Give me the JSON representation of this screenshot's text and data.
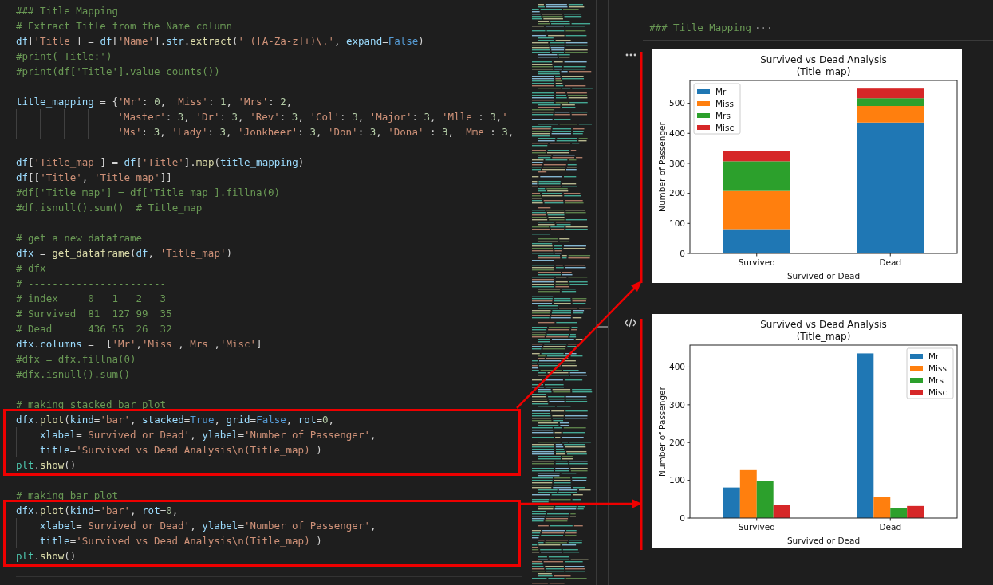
{
  "editor": {
    "sections": [
      {
        "highlighted": false,
        "lines": [
          {
            "tokens": [
              {
                "kind": "comment",
                "text": "### Title Mapping"
              }
            ]
          },
          {
            "tokens": [
              {
                "kind": "comment",
                "text": "# Extract Title from the Name column"
              }
            ]
          },
          {
            "tokens": [
              {
                "kind": "name",
                "text": "df"
              },
              {
                "kind": "plain",
                "text": "["
              },
              {
                "kind": "string",
                "text": "'Title'"
              },
              {
                "kind": "plain",
                "text": "] = "
              },
              {
                "kind": "name",
                "text": "df"
              },
              {
                "kind": "plain",
                "text": "["
              },
              {
                "kind": "string",
                "text": "'Name'"
              },
              {
                "kind": "plain",
                "text": "]."
              },
              {
                "kind": "name",
                "text": "str"
              },
              {
                "kind": "plain",
                "text": "."
              },
              {
                "kind": "func",
                "text": "extract"
              },
              {
                "kind": "plain",
                "text": "("
              },
              {
                "kind": "string",
                "text": "' ([A-Za-z]+)\\.'"
              },
              {
                "kind": "plain",
                "text": ", "
              },
              {
                "kind": "name",
                "text": "expand"
              },
              {
                "kind": "plain",
                "text": "="
              },
              {
                "kind": "const",
                "text": "False"
              },
              {
                "kind": "plain",
                "text": ")"
              }
            ]
          },
          {
            "tokens": [
              {
                "kind": "comment",
                "text": "#print('Title:')"
              }
            ]
          },
          {
            "tokens": [
              {
                "kind": "comment",
                "text": "#print(df['Title'].value_counts())"
              }
            ]
          },
          {
            "kind": "blank"
          },
          {
            "tokens": [
              {
                "kind": "name",
                "text": "title_mapping"
              },
              {
                "kind": "plain",
                "text": " = {"
              },
              {
                "kind": "string",
                "text": "'Mr'"
              },
              {
                "kind": "plain",
                "text": ": "
              },
              {
                "kind": "number",
                "text": "0"
              },
              {
                "kind": "plain",
                "text": ", "
              },
              {
                "kind": "string",
                "text": "'Miss'"
              },
              {
                "kind": "plain",
                "text": ": "
              },
              {
                "kind": "number",
                "text": "1"
              },
              {
                "kind": "plain",
                "text": ", "
              },
              {
                "kind": "string",
                "text": "'Mrs'"
              },
              {
                "kind": "plain",
                "text": ": "
              },
              {
                "kind": "number",
                "text": "2"
              },
              {
                "kind": "plain",
                "text": ","
              }
            ]
          },
          {
            "kind": "dict-continuation",
            "tokens": [
              {
                "kind": "string",
                "text": "'Master'"
              },
              {
                "kind": "plain",
                "text": ": "
              },
              {
                "kind": "number",
                "text": "3"
              },
              {
                "kind": "plain",
                "text": ", "
              },
              {
                "kind": "string",
                "text": "'Dr'"
              },
              {
                "kind": "plain",
                "text": ": "
              },
              {
                "kind": "number",
                "text": "3"
              },
              {
                "kind": "plain",
                "text": ", "
              },
              {
                "kind": "string",
                "text": "'Rev'"
              },
              {
                "kind": "plain",
                "text": ": "
              },
              {
                "kind": "number",
                "text": "3"
              },
              {
                "kind": "plain",
                "text": ", "
              },
              {
                "kind": "string",
                "text": "'Col'"
              },
              {
                "kind": "plain",
                "text": ": "
              },
              {
                "kind": "number",
                "text": "3"
              },
              {
                "kind": "plain",
                "text": ", "
              },
              {
                "kind": "string",
                "text": "'Major'"
              },
              {
                "kind": "plain",
                "text": ": "
              },
              {
                "kind": "number",
                "text": "3"
              },
              {
                "kind": "plain",
                "text": ", "
              },
              {
                "kind": "string",
                "text": "'Mlle'"
              },
              {
                "kind": "plain",
                "text": ": "
              },
              {
                "kind": "number",
                "text": "3"
              },
              {
                "kind": "plain",
                "text": ","
              },
              {
                "kind": "string",
                "text": "'"
              }
            ]
          },
          {
            "kind": "dict-continuation",
            "tokens": [
              {
                "kind": "string",
                "text": "'Ms'"
              },
              {
                "kind": "plain",
                "text": ": "
              },
              {
                "kind": "number",
                "text": "3"
              },
              {
                "kind": "plain",
                "text": ", "
              },
              {
                "kind": "string",
                "text": "'Lady'"
              },
              {
                "kind": "plain",
                "text": ": "
              },
              {
                "kind": "number",
                "text": "3"
              },
              {
                "kind": "plain",
                "text": ", "
              },
              {
                "kind": "string",
                "text": "'Jonkheer'"
              },
              {
                "kind": "plain",
                "text": ": "
              },
              {
                "kind": "number",
                "text": "3"
              },
              {
                "kind": "plain",
                "text": ", "
              },
              {
                "kind": "string",
                "text": "'Don'"
              },
              {
                "kind": "plain",
                "text": ": "
              },
              {
                "kind": "number",
                "text": "3"
              },
              {
                "kind": "plain",
                "text": ", "
              },
              {
                "kind": "string",
                "text": "'Dona'"
              },
              {
                "kind": "plain",
                "text": " : "
              },
              {
                "kind": "number",
                "text": "3"
              },
              {
                "kind": "plain",
                "text": ", "
              },
              {
                "kind": "string",
                "text": "'Mme'"
              },
              {
                "kind": "plain",
                "text": ": "
              },
              {
                "kind": "number",
                "text": "3"
              },
              {
                "kind": "plain",
                "text": ","
              }
            ]
          },
          {
            "kind": "blank"
          },
          {
            "tokens": [
              {
                "kind": "name",
                "text": "df"
              },
              {
                "kind": "plain",
                "text": "["
              },
              {
                "kind": "string",
                "text": "'Title_map'"
              },
              {
                "kind": "plain",
                "text": "] = "
              },
              {
                "kind": "name",
                "text": "df"
              },
              {
                "kind": "plain",
                "text": "["
              },
              {
                "kind": "string",
                "text": "'Title'"
              },
              {
                "kind": "plain",
                "text": "]."
              },
              {
                "kind": "func",
                "text": "map"
              },
              {
                "kind": "plain",
                "text": "("
              },
              {
                "kind": "name",
                "text": "title_mapping"
              },
              {
                "kind": "plain",
                "text": ")"
              }
            ]
          },
          {
            "tokens": [
              {
                "kind": "name",
                "text": "df"
              },
              {
                "kind": "plain",
                "text": "[["
              },
              {
                "kind": "string",
                "text": "'Title'"
              },
              {
                "kind": "plain",
                "text": ", "
              },
              {
                "kind": "string",
                "text": "'Title_map'"
              },
              {
                "kind": "plain",
                "text": "]]"
              }
            ]
          },
          {
            "tokens": [
              {
                "kind": "comment",
                "text": "#df['Title_map'] = df['Title_map'].fillna(0)"
              }
            ]
          },
          {
            "tokens": [
              {
                "kind": "comment",
                "text": "#df.isnull().sum()  # Title_map"
              }
            ]
          },
          {
            "kind": "blank"
          },
          {
            "tokens": [
              {
                "kind": "comment",
                "text": "# get a new dataframe"
              }
            ]
          },
          {
            "tokens": [
              {
                "kind": "name",
                "text": "dfx"
              },
              {
                "kind": "plain",
                "text": " = "
              },
              {
                "kind": "func",
                "text": "get_dataframe"
              },
              {
                "kind": "plain",
                "text": "("
              },
              {
                "kind": "name",
                "text": "df"
              },
              {
                "kind": "plain",
                "text": ", "
              },
              {
                "kind": "string",
                "text": "'Title_map'"
              },
              {
                "kind": "plain",
                "text": ")"
              }
            ]
          },
          {
            "tokens": [
              {
                "kind": "comment",
                "text": "# dfx"
              }
            ]
          },
          {
            "tokens": [
              {
                "kind": "comment",
                "text": "# -----------------------"
              }
            ]
          },
          {
            "tokens": [
              {
                "kind": "comment",
                "text": "# index     0   1   2   3"
              }
            ]
          },
          {
            "tokens": [
              {
                "kind": "comment",
                "text": "# Survived  81  127 99  35"
              }
            ]
          },
          {
            "tokens": [
              {
                "kind": "comment",
                "text": "# Dead      436 55  26  32"
              }
            ]
          },
          {
            "tokens": [
              {
                "kind": "name",
                "text": "dfx"
              },
              {
                "kind": "plain",
                "text": "."
              },
              {
                "kind": "name",
                "text": "columns"
              },
              {
                "kind": "plain",
                "text": " =  ["
              },
              {
                "kind": "string",
                "text": "'Mr'"
              },
              {
                "kind": "plain",
                "text": ","
              },
              {
                "kind": "string",
                "text": "'Miss'"
              },
              {
                "kind": "plain",
                "text": ","
              },
              {
                "kind": "string",
                "text": "'Mrs'"
              },
              {
                "kind": "plain",
                "text": ","
              },
              {
                "kind": "string",
                "text": "'Misc'"
              },
              {
                "kind": "plain",
                "text": "]"
              }
            ]
          },
          {
            "tokens": [
              {
                "kind": "comment",
                "text": "#dfx = dfx.fillna(0)"
              }
            ]
          },
          {
            "tokens": [
              {
                "kind": "comment",
                "text": "#dfx.isnull().sum()"
              }
            ]
          },
          {
            "kind": "blank"
          },
          {
            "tokens": [
              {
                "kind": "comment",
                "text": "# making stacked bar plot"
              }
            ]
          }
        ]
      },
      {
        "highlighted": true,
        "lines": [
          {
            "tokens": [
              {
                "kind": "name",
                "text": "dfx"
              },
              {
                "kind": "plain",
                "text": "."
              },
              {
                "kind": "func",
                "text": "plot"
              },
              {
                "kind": "plain",
                "text": "("
              },
              {
                "kind": "name",
                "text": "kind"
              },
              {
                "kind": "plain",
                "text": "="
              },
              {
                "kind": "string",
                "text": "'bar'"
              },
              {
                "kind": "plain",
                "text": ", "
              },
              {
                "kind": "name",
                "text": "stacked"
              },
              {
                "kind": "plain",
                "text": "="
              },
              {
                "kind": "const",
                "text": "True"
              },
              {
                "kind": "plain",
                "text": ", "
              },
              {
                "kind": "name",
                "text": "grid"
              },
              {
                "kind": "plain",
                "text": "="
              },
              {
                "kind": "const",
                "text": "False"
              },
              {
                "kind": "plain",
                "text": ", "
              },
              {
                "kind": "name",
                "text": "rot"
              },
              {
                "kind": "plain",
                "text": "="
              },
              {
                "kind": "number",
                "text": "0"
              },
              {
                "kind": "plain",
                "text": ","
              }
            ]
          },
          {
            "kind": "arg-continuation",
            "tokens": [
              {
                "kind": "name",
                "text": "xlabel"
              },
              {
                "kind": "plain",
                "text": "="
              },
              {
                "kind": "string",
                "text": "'Survived or Dead'"
              },
              {
                "kind": "plain",
                "text": ", "
              },
              {
                "kind": "name",
                "text": "ylabel"
              },
              {
                "kind": "plain",
                "text": "="
              },
              {
                "kind": "string",
                "text": "'Number of Passenger'"
              },
              {
                "kind": "plain",
                "text": ","
              }
            ]
          },
          {
            "kind": "arg-continuation",
            "tokens": [
              {
                "kind": "name",
                "text": "title"
              },
              {
                "kind": "plain",
                "text": "="
              },
              {
                "kind": "string",
                "text": "'Survived vs Dead Analysis\\n(Title_map)'"
              },
              {
                "kind": "plain",
                "text": ")"
              }
            ]
          },
          {
            "tokens": [
              {
                "kind": "module",
                "text": "plt"
              },
              {
                "kind": "plain",
                "text": "."
              },
              {
                "kind": "func",
                "text": "show"
              },
              {
                "kind": "plain",
                "text": "()"
              }
            ]
          }
        ]
      },
      {
        "highlighted": false,
        "lines": [
          {
            "kind": "blank"
          },
          {
            "tokens": [
              {
                "kind": "comment",
                "text": "# making bar plot"
              }
            ]
          }
        ]
      },
      {
        "highlighted": true,
        "lines": [
          {
            "tokens": [
              {
                "kind": "name",
                "text": "dfx"
              },
              {
                "kind": "plain",
                "text": "."
              },
              {
                "kind": "func",
                "text": "plot"
              },
              {
                "kind": "plain",
                "text": "("
              },
              {
                "kind": "name",
                "text": "kind"
              },
              {
                "kind": "plain",
                "text": "="
              },
              {
                "kind": "string",
                "text": "'bar'"
              },
              {
                "kind": "plain",
                "text": ", "
              },
              {
                "kind": "name",
                "text": "rot"
              },
              {
                "kind": "plain",
                "text": "="
              },
              {
                "kind": "number",
                "text": "0"
              },
              {
                "kind": "plain",
                "text": ","
              }
            ]
          },
          {
            "kind": "arg-continuation",
            "tokens": [
              {
                "kind": "name",
                "text": "xlabel"
              },
              {
                "kind": "plain",
                "text": "="
              },
              {
                "kind": "string",
                "text": "'Survived or Dead'"
              },
              {
                "kind": "plain",
                "text": ", "
              },
              {
                "kind": "name",
                "text": "ylabel"
              },
              {
                "kind": "plain",
                "text": "="
              },
              {
                "kind": "string",
                "text": "'Number of Passenger'"
              },
              {
                "kind": "plain",
                "text": ","
              }
            ]
          },
          {
            "kind": "arg-continuation",
            "tokens": [
              {
                "kind": "name",
                "text": "title"
              },
              {
                "kind": "plain",
                "text": "="
              },
              {
                "kind": "string",
                "text": "'Survived vs Dead Analysis\\n(Title_map)'"
              },
              {
                "kind": "plain",
                "text": ")"
              }
            ]
          },
          {
            "tokens": [
              {
                "kind": "module",
                "text": "plt"
              },
              {
                "kind": "plain",
                "text": "."
              },
              {
                "kind": "func",
                "text": "show"
              },
              {
                "kind": "plain",
                "text": "()"
              }
            ]
          }
        ]
      }
    ]
  },
  "output": {
    "header": "### Title Mapping",
    "header_more": "···",
    "cells": [
      {
        "chart_data": {
          "type": "bar",
          "stacked": true,
          "legend": "upper left",
          "title": "Survived vs Dead Analysis\n(Title_map)",
          "xlabel": "Survived or Dead",
          "ylabel": "Number of Passenger",
          "categories": [
            "Survived",
            "Dead"
          ],
          "ylim": [
            0,
            576
          ],
          "yticks": [
            0,
            100,
            200,
            300,
            400,
            500
          ],
          "series": [
            {
              "name": "Mr",
              "color": "#1f77b4",
              "values": [
                81,
                436
              ]
            },
            {
              "name": "Miss",
              "color": "#ff7f0e",
              "values": [
                127,
                55
              ]
            },
            {
              "name": "Mrs",
              "color": "#2ca02c",
              "values": [
                99,
                26
              ]
            },
            {
              "name": "Misc",
              "color": "#d62728",
              "values": [
                35,
                32
              ]
            }
          ]
        }
      },
      {
        "chart_data": {
          "type": "bar",
          "stacked": false,
          "legend": "upper right",
          "title": "Survived vs Dead Analysis\n(Title_map)",
          "xlabel": "Survived or Dead",
          "ylabel": "Number of Passenger",
          "categories": [
            "Survived",
            "Dead"
          ],
          "ylim": [
            0,
            458
          ],
          "yticks": [
            0,
            100,
            200,
            300,
            400
          ],
          "series": [
            {
              "name": "Mr",
              "color": "#1f77b4",
              "values": [
                81,
                436
              ]
            },
            {
              "name": "Miss",
              "color": "#ff7f0e",
              "values": [
                127,
                55
              ]
            },
            {
              "name": "Mrs",
              "color": "#2ca02c",
              "values": [
                99,
                26
              ]
            },
            {
              "name": "Misc",
              "color": "#d62728",
              "values": [
                35,
                32
              ]
            }
          ]
        }
      }
    ]
  }
}
